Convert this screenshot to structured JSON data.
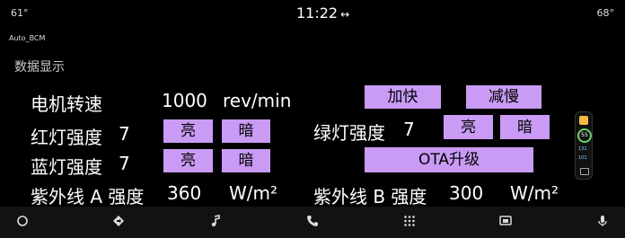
{
  "status": {
    "left_temp": "61°",
    "time": "11:22",
    "right_temp": "68°",
    "sync_icon": "swap-horiz-icon"
  },
  "app": {
    "title": "Auto_BCM",
    "section": "数据显示"
  },
  "motor": {
    "label": "电机转速",
    "value": "1000",
    "unit": "rev/min",
    "faster": "加快",
    "slower": "减慢"
  },
  "red": {
    "label": "红灯强度",
    "value": "7",
    "bright": "亮",
    "dark": "暗"
  },
  "green": {
    "label": "绿灯强度",
    "value": "7",
    "bright": "亮",
    "dark": "暗"
  },
  "blue": {
    "label": "蓝灯强度",
    "value": "7",
    "bright": "亮",
    "dark": "暗"
  },
  "ota": {
    "label": "OTA升级"
  },
  "uva": {
    "label": "紫外线 A 强度",
    "value": "360",
    "unit": "W/m²"
  },
  "uvb": {
    "label": "紫外线 B 强度",
    "value": "300",
    "unit": "W/m²"
  },
  "side_widget": {
    "level": "55",
    "line1": "131",
    "line2": "101"
  },
  "nav": [
    "home-icon",
    "navigation-icon",
    "music-icon",
    "phone-icon",
    "apps-grid-icon",
    "cast-icon",
    "microphone-icon"
  ]
}
